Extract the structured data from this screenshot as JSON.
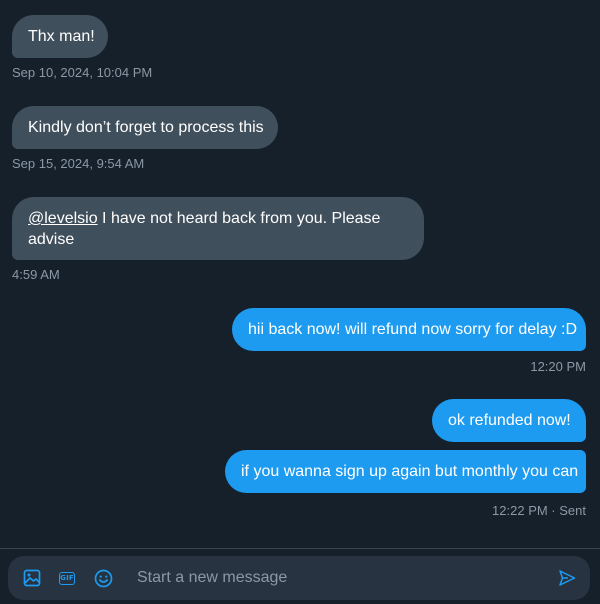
{
  "messages": [
    {
      "text": "Thx man!",
      "direction": "incoming",
      "timestamp": "Sep 10, 2024, 10:04 PM"
    },
    {
      "text": "Kindly don’t forget to process this",
      "direction": "incoming",
      "timestamp": "Sep 15, 2024, 9:54 AM"
    },
    {
      "mention": "@levelsio",
      "text": " I have not heard back from you. Please advise",
      "direction": "incoming",
      "timestamp": "4:59 AM"
    },
    {
      "text": "hii back now! will refund now sorry for delay :D",
      "direction": "outgoing",
      "timestamp": "12:20 PM"
    },
    {
      "text": "ok refunded now!",
      "direction": "outgoing"
    },
    {
      "text": "if you wanna sign up again but monthly you can",
      "direction": "outgoing",
      "timestamp": "12:22 PM · Sent"
    }
  ],
  "composer": {
    "placeholder": "Start a new message",
    "gif_label": "GIF",
    "icons": [
      "image-icon",
      "gif-icon",
      "emoji-icon",
      "send-icon"
    ]
  },
  "colors": {
    "background": "#15202b",
    "incoming_bubble": "#404f5c",
    "outgoing_bubble": "#1d9bf0",
    "timestamp": "#8b98a5",
    "composer_bg": "#273340"
  }
}
